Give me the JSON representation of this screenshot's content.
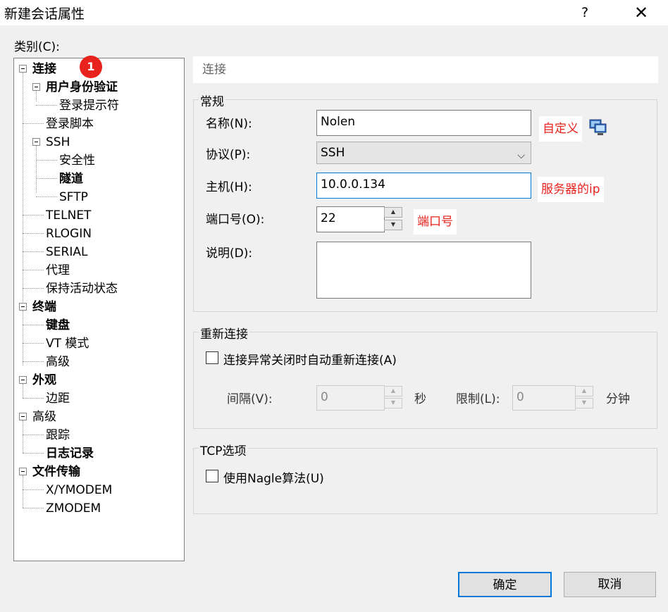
{
  "window": {
    "title": "新建会话属性",
    "help": "?",
    "close": "✕"
  },
  "category_label": "类别(C):",
  "badge": "1",
  "tree": [
    {
      "label": "连接",
      "bold": true
    },
    {
      "label": "用户身份验证",
      "bold": true
    },
    {
      "label": "登录提示符",
      "bold": false
    },
    {
      "label": "登录脚本",
      "bold": false
    },
    {
      "label": "SSH",
      "bold": false
    },
    {
      "label": "安全性",
      "bold": false
    },
    {
      "label": "隧道",
      "bold": true
    },
    {
      "label": "SFTP",
      "bold": false
    },
    {
      "label": "TELNET",
      "bold": false
    },
    {
      "label": "RLOGIN",
      "bold": false
    },
    {
      "label": "SERIAL",
      "bold": false
    },
    {
      "label": "代理",
      "bold": false
    },
    {
      "label": "保持活动状态",
      "bold": false
    },
    {
      "label": "终端",
      "bold": true
    },
    {
      "label": "键盘",
      "bold": true
    },
    {
      "label": "VT 模式",
      "bold": false
    },
    {
      "label": "高级",
      "bold": false
    },
    {
      "label": "外观",
      "bold": true
    },
    {
      "label": "边距",
      "bold": false
    },
    {
      "label": "高级",
      "bold": false
    },
    {
      "label": "跟踪",
      "bold": false
    },
    {
      "label": "日志记录",
      "bold": true
    },
    {
      "label": "文件传输",
      "bold": true
    },
    {
      "label": "X/YMODEM",
      "bold": false
    },
    {
      "label": "ZMODEM",
      "bold": false
    }
  ],
  "section_title": "连接",
  "general": {
    "legend": "常规",
    "name_label": "名称(N):",
    "name_value": "Nolen",
    "protocol_label": "协议(P):",
    "protocol_value": "SSH",
    "host_label": "主机(H):",
    "host_value": "10.0.0.134",
    "port_label": "端口号(O):",
    "port_value": "22",
    "desc_label": "说明(D):",
    "desc_value": ""
  },
  "annotations": {
    "name_note": "自定义",
    "host_note": "服务器的ip",
    "port_note": "端口号"
  },
  "reconnect": {
    "legend": "重新连接",
    "checkbox_label": "连接异常关闭时自动重新连接(A)",
    "checked": false,
    "interval_label": "间隔(V):",
    "interval_value": "0",
    "interval_unit": "秒",
    "limit_label": "限制(L):",
    "limit_value": "0",
    "limit_unit": "分钟"
  },
  "tcp": {
    "legend": "TCP选项",
    "nagle_label": "使用Nagle算法(U)",
    "checked": false
  },
  "buttons": {
    "ok": "确定",
    "cancel": "取消"
  },
  "colors": {
    "annotation_red": "#e8221c",
    "focus_blue": "#0078d7"
  }
}
